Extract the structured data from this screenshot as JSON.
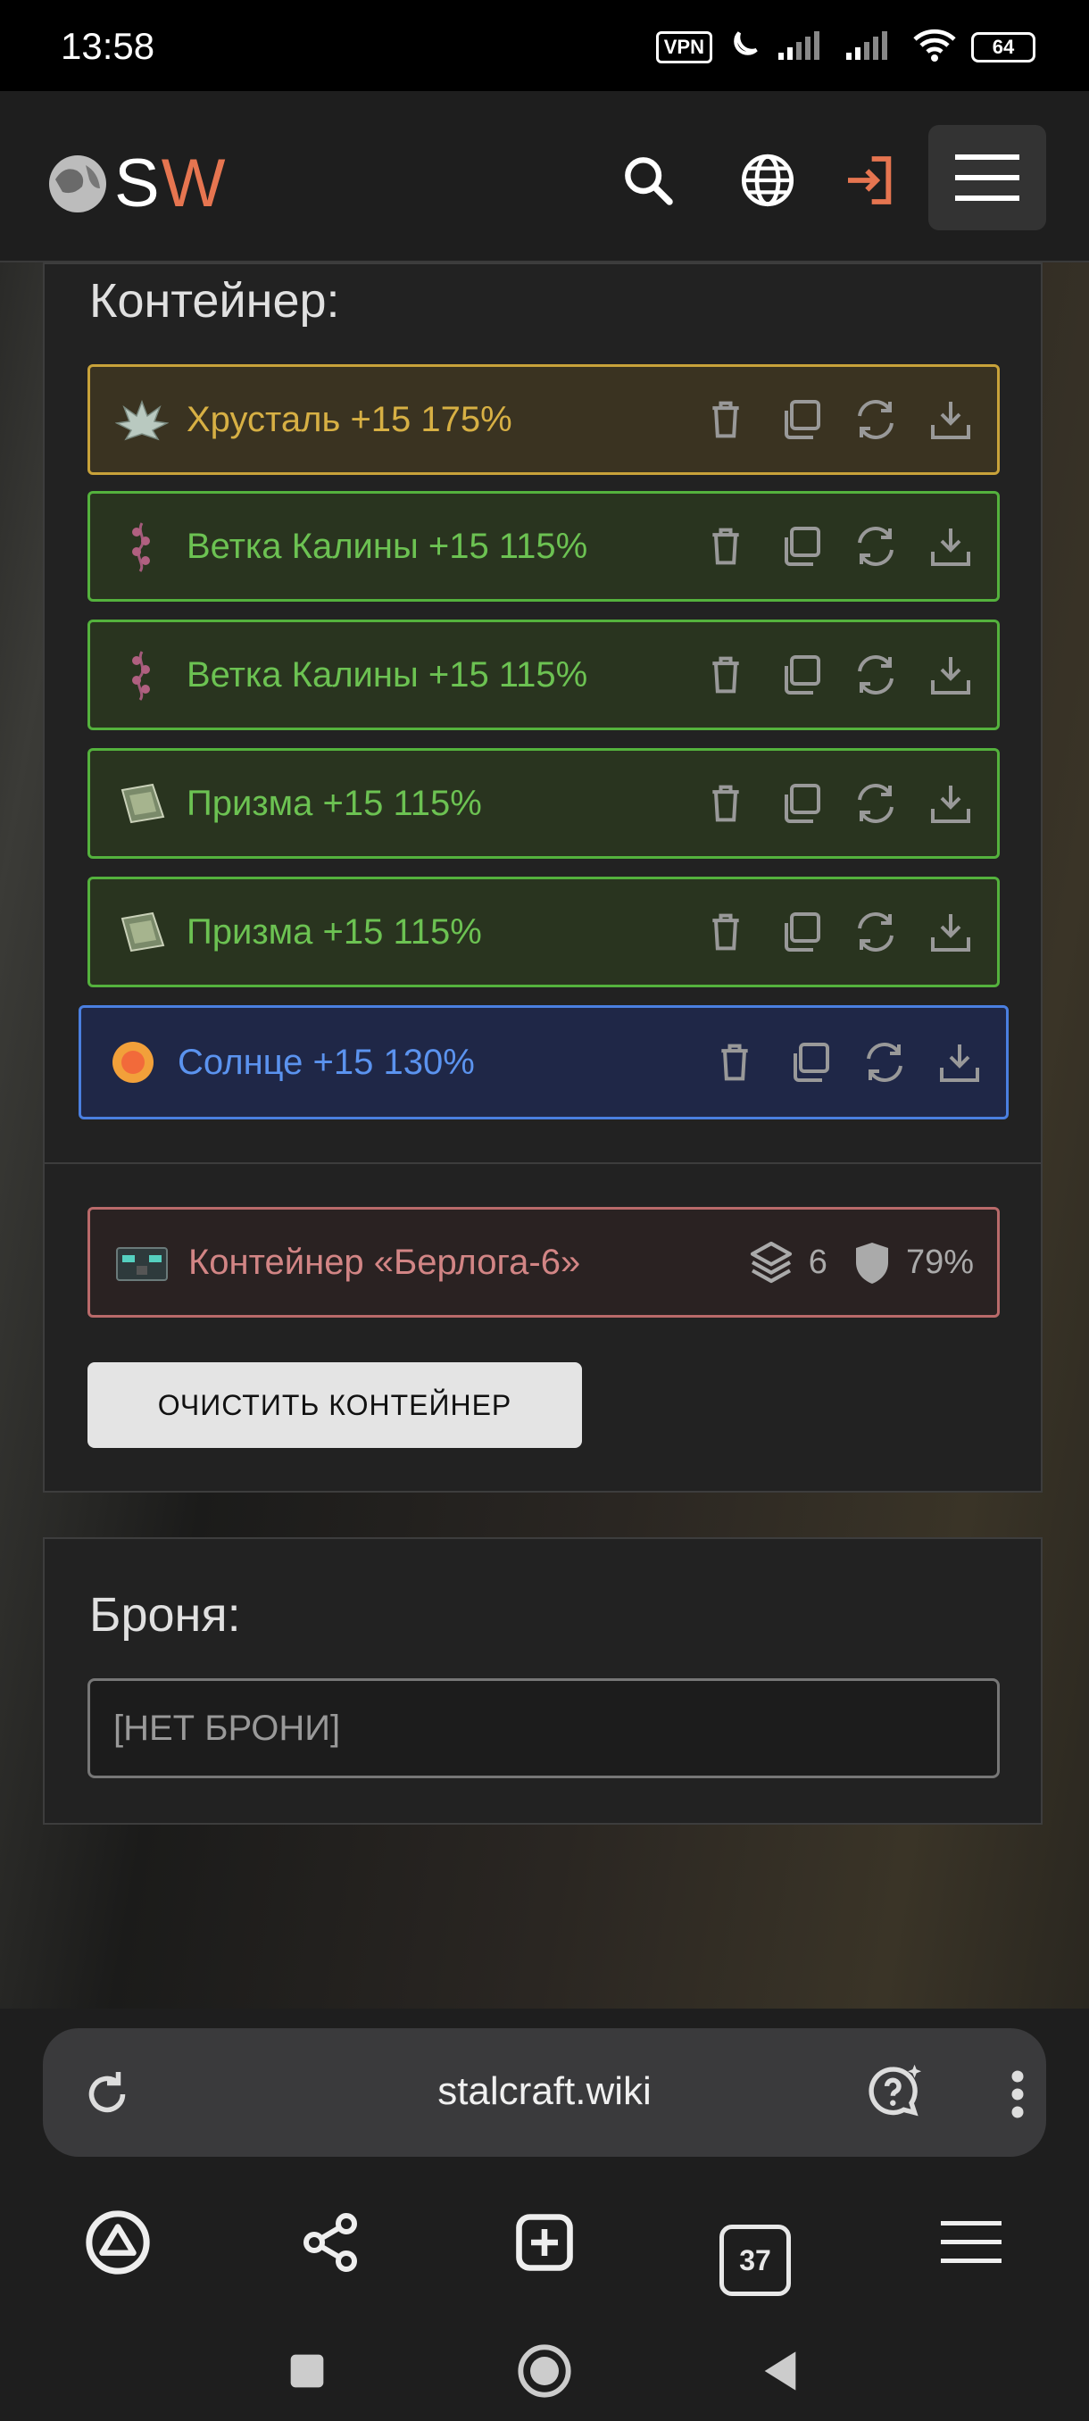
{
  "status_bar": {
    "time": "13:58",
    "vpn_label": "VPN",
    "battery": "64"
  },
  "header": {
    "logo_s": "S",
    "logo_w": "W"
  },
  "container_panel": {
    "title": "Контейнер:",
    "items": [
      {
        "name": "Хрусталь +15 175%",
        "rarity": "gold"
      },
      {
        "name": "Ветка Калины +15 115%",
        "rarity": "green"
      },
      {
        "name": "Ветка Калины +15 115%",
        "rarity": "green"
      },
      {
        "name": "Призма +15 115%",
        "rarity": "green"
      },
      {
        "name": "Призма +15 115%",
        "rarity": "green"
      },
      {
        "name": "Солнце +15 130%",
        "rarity": "blue"
      }
    ],
    "container": {
      "name": "Контейнер «Берлога-6»",
      "slots": "6",
      "protection": "79%"
    },
    "clear_button": "ОЧИСТИТЬ КОНТЕЙНЕР"
  },
  "armor_panel": {
    "title": "Броня:",
    "value": "[НЕТ БРОНИ]"
  },
  "browser": {
    "url": "stalcraft.wiki",
    "tab_count": "37"
  },
  "colors": {
    "gold": "#d7b044",
    "green": "#6cc252",
    "blue": "#5b93ef",
    "accent": "#e67550"
  }
}
